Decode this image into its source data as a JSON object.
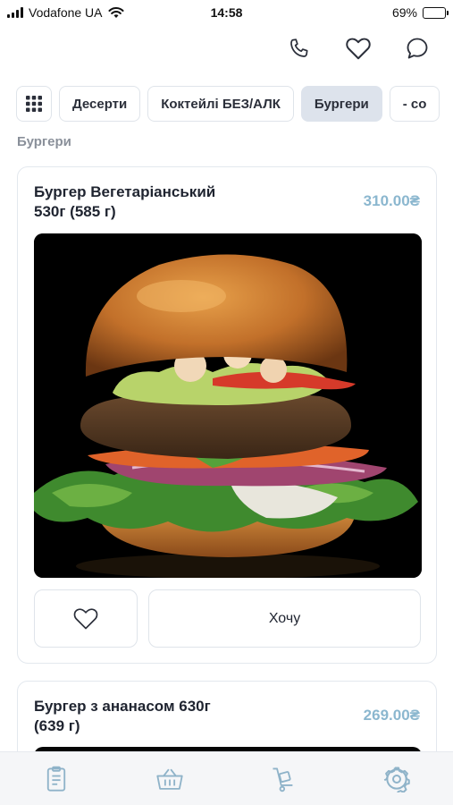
{
  "status_bar": {
    "carrier": "Vodafone UA",
    "time": "14:58",
    "battery_percent": "69%",
    "battery_level": 0.69
  },
  "top_actions": {
    "icons": [
      "phone-icon",
      "heart-icon",
      "chat-icon"
    ]
  },
  "categories": {
    "menu_icon": "grid-icon",
    "items": [
      {
        "label": "Десерти",
        "active": false
      },
      {
        "label": "Коктейлі БЕЗ/АЛК",
        "active": false
      },
      {
        "label": "Бургери",
        "active": true
      },
      {
        "label": "- со",
        "active": false
      }
    ]
  },
  "section": {
    "title": "Бургери"
  },
  "products": [
    {
      "title_line1": "Бургер Вегетаріанський",
      "title_line2": "530г (585 г)",
      "price": "310.00₴",
      "want_label": "Хочу"
    },
    {
      "title_line1": "Бургер з ананасом 630г",
      "title_line2": "(639 г)",
      "price": "269.00₴"
    }
  ],
  "bottom_nav": {
    "items": [
      "menu-list-icon",
      "basket-icon",
      "delivery-cart-icon",
      "settings-icon"
    ]
  },
  "colors": {
    "accent_price": "#8bb7cf",
    "active_chip": "#dde3ec",
    "nav_icon": "#8fb3c9"
  }
}
